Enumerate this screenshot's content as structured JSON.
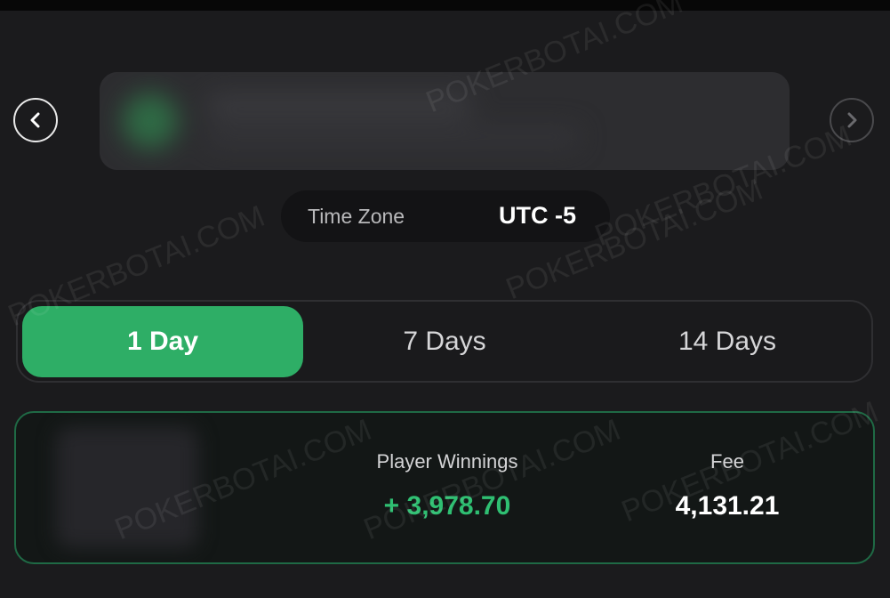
{
  "nav": {
    "prev_icon": "chevron-left-icon",
    "next_icon": "chevron-right-icon"
  },
  "timezone": {
    "label": "Time Zone",
    "value": "UTC -5"
  },
  "tabs": [
    {
      "label": "1 Day",
      "active": true
    },
    {
      "label": "7 Days",
      "active": false
    },
    {
      "label": "14 Days",
      "active": false
    }
  ],
  "stats": {
    "player_winnings_label": "Player Winnings",
    "player_winnings_value": "+ 3,978.70",
    "fee_label": "Fee",
    "fee_value": "4,131.21"
  },
  "watermark": {
    "text": "POKERBOTAI.COM"
  },
  "colors": {
    "accent": "#2eae66",
    "positive": "#2fbf72",
    "background": "#1b1b1d"
  }
}
